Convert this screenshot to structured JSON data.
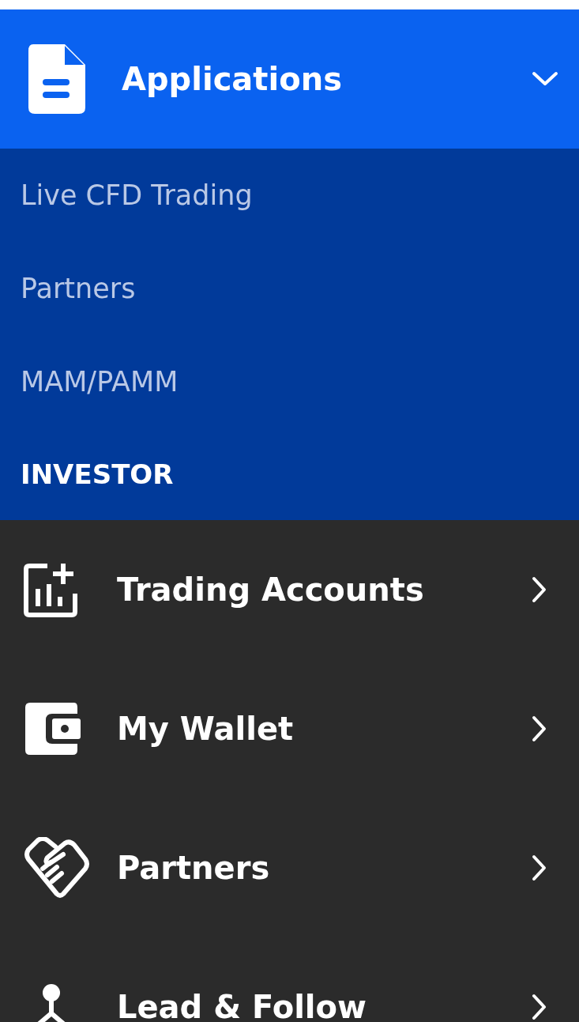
{
  "menu": {
    "label": "Applications",
    "kind": "document",
    "expanded": true,
    "children": [
      {
        "label": "Live CFD Trading"
      },
      {
        "label": "Partners"
      },
      {
        "label": "MAM/PAMM"
      }
    ],
    "section": "INVESTOR"
  },
  "items": [
    {
      "label": "Trading Accounts",
      "kind": "chart"
    },
    {
      "label": "My Wallet",
      "kind": "wallet"
    },
    {
      "label": "Partners",
      "kind": "handshake"
    },
    {
      "label": "Lead & Follow",
      "kind": "network"
    }
  ]
}
